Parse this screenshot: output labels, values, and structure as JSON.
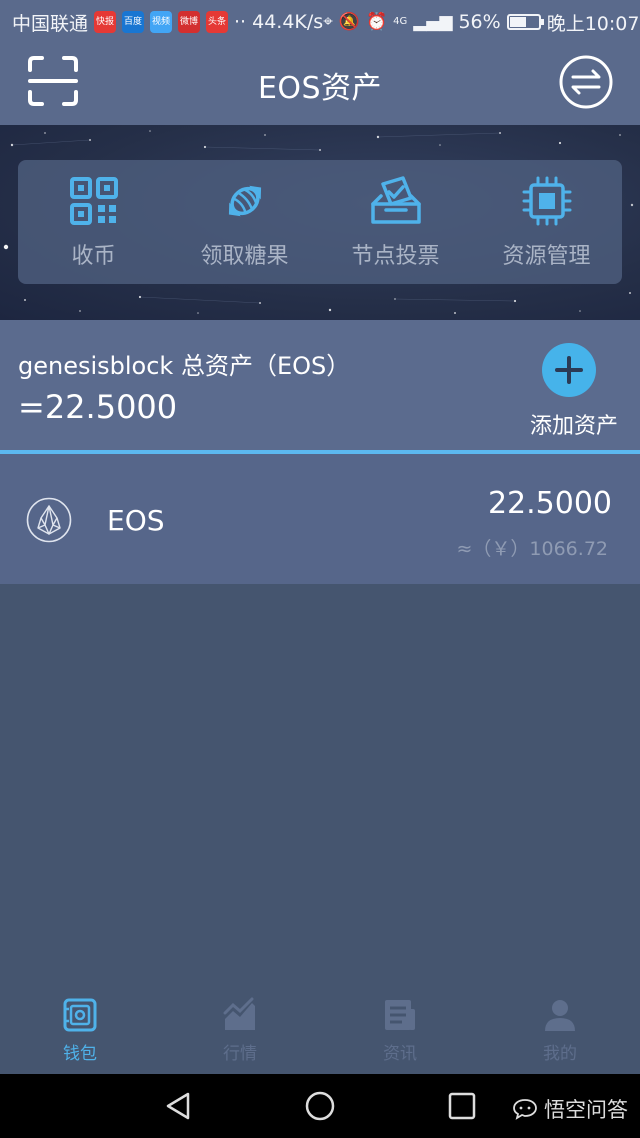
{
  "status_bar": {
    "carrier": "中国联通",
    "apps": [
      {
        "name": "快报",
        "color": "#e53935"
      },
      {
        "name": "百度",
        "color": "#1976d2"
      },
      {
        "name": "视频",
        "color": "#42a5f5"
      },
      {
        "name": "微博",
        "color": "#d32f2f"
      },
      {
        "name": "头条",
        "color": "#e53935"
      }
    ],
    "dots": "··",
    "speed": "44.4K/s",
    "network": "4G",
    "battery_pct": "56%",
    "battery_level": 0.56,
    "time": "晚上10:07"
  },
  "header": {
    "title": "EOS资产",
    "left_icon": "scan-icon",
    "right_icon": "switch-account-icon"
  },
  "actions": [
    {
      "label": "收币",
      "icon": "qr-code-icon"
    },
    {
      "label": "领取糖果",
      "icon": "candy-icon"
    },
    {
      "label": "节点投票",
      "icon": "vote-box-icon"
    },
    {
      "label": "资源管理",
      "icon": "chip-icon"
    }
  ],
  "summary": {
    "title": "genesisblock 总资产（EOS）",
    "total": "=22.5000",
    "add_label": "添加资产"
  },
  "assets": [
    {
      "name": "EOS",
      "amount": "22.5000",
      "fiat": "≈（￥）1066.72",
      "icon": "eos-logo-icon"
    }
  ],
  "tabs": [
    {
      "label": "钱包",
      "icon": "wallet-icon",
      "active": true
    },
    {
      "label": "行情",
      "icon": "chart-icon",
      "active": false
    },
    {
      "label": "资讯",
      "icon": "news-icon",
      "active": false
    },
    {
      "label": "我的",
      "icon": "profile-icon",
      "active": false
    }
  ],
  "watermark": "悟空问答",
  "colors": {
    "header_bg": "#5a6a8c",
    "accent_blue": "#46b3ea",
    "icon_blue": "#4fb2ea",
    "page_bg": "#45556f"
  }
}
